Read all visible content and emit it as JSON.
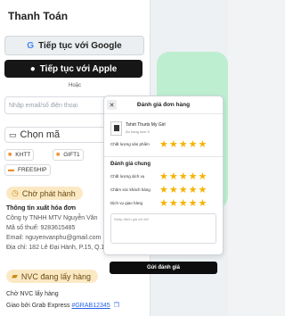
{
  "page": {
    "title": "Thanh Toán",
    "google_button": "Tiếp tục với Google",
    "apple_button": "Tiếp tục với Apple",
    "or_label": "Hoặc",
    "email_placeholder": "Nhập email/số điện thoại",
    "voucher_label": "Chọn mã",
    "chips": [
      {
        "label": "KHTT",
        "icon": "gift-icon"
      },
      {
        "label": "GIFT1",
        "icon": "gift-icon"
      },
      {
        "label": "FREESHIP",
        "icon": "truck-icon"
      }
    ],
    "status_issue": "Chờ phát hành",
    "invoice": {
      "heading": "Thông tin xuất hóa đơn",
      "company": "Công ty TNHH MTV Nguyễn Văn",
      "tax_code": "Mã số thuế: 9283615485",
      "email": "Email: nguyenvanphu@gmail.com",
      "address": "Địa chỉ: 182 Lê Đại Hành, P.15, Q.11"
    },
    "status_shipping": "NVC đang lấy hàng",
    "shipping_wait": "Chờ NVC lấy hàng",
    "shipping_via": "Giao bởi Grab Express",
    "tracking_code": "#GRAB12345"
  },
  "modal": {
    "title": "Đánh giá đơn hàng",
    "product_name": "Tshirt Thurts My Girl",
    "product_variant": "Áo hàng size S",
    "product_quality_label": "Chất lượng sản phẩm",
    "product_quality_rating": 5,
    "general_title": "Đánh giá chung",
    "ratings": [
      {
        "label": "Chất lượng dịch vụ",
        "rating": 5
      },
      {
        "label": "Chăm sóc khách hàng",
        "rating": 5
      },
      {
        "label": "Dịch vụ giao hàng",
        "rating": 5
      }
    ],
    "comment_placeholder": "Nhập đánh giá chi tiết",
    "submit_label": "Gửi đánh giá"
  },
  "colors": {
    "star": "#f5b301",
    "accent": "#2563eb",
    "mint_panel": "#bdeed0",
    "status_bg": "#fbe9c4"
  }
}
